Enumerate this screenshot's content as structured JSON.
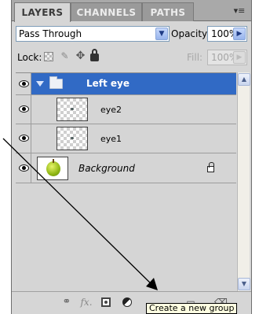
{
  "tabs": [
    {
      "label": "LAYERS",
      "active": true
    },
    {
      "label": "CHANNELS",
      "active": false
    },
    {
      "label": "PATHS",
      "active": false
    }
  ],
  "panel_menu_icon": "panel-menu-icon",
  "blend": {
    "mode": "Pass Through",
    "opacity_label": "Opacity:",
    "opacity_value": "100%"
  },
  "lock": {
    "label": "Lock:",
    "fill_label": "Fill:",
    "fill_value": "100%"
  },
  "layers": [
    {
      "name": "Left eye",
      "type": "group",
      "selected": true,
      "visible": true
    },
    {
      "name": "eye2",
      "type": "layer",
      "selected": false,
      "visible": true
    },
    {
      "name": "eye1",
      "type": "layer",
      "selected": false,
      "visible": true
    },
    {
      "name": "Background",
      "type": "background",
      "selected": false,
      "visible": true,
      "locked": true
    }
  ],
  "toolbar_icons": [
    "link-icon",
    "fx-icon",
    "mask-icon",
    "adjustment-icon",
    "new-group-icon",
    "new-layer-icon",
    "delete-icon"
  ],
  "tooltip": "Create a new group",
  "colors": {
    "selection": "#316ac5",
    "panel_bg": "#d6d6d6",
    "tab_strip": "#a9a9a9",
    "tooltip_bg": "#ffffe1"
  }
}
